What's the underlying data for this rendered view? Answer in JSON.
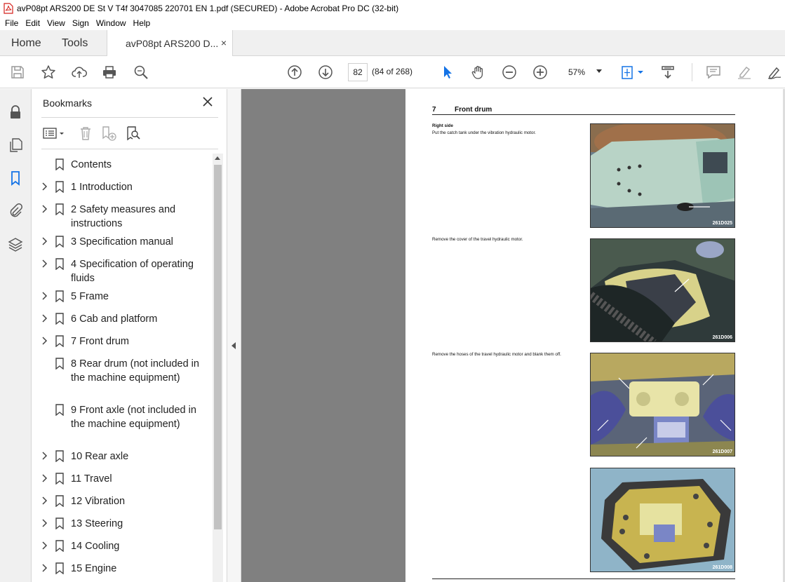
{
  "window": {
    "title": "avP08pt ARS200 DE St V T4f 3047085 220701 EN 1.pdf (SECURED) - Adobe Acrobat Pro DC (32-bit)"
  },
  "menu": [
    "File",
    "Edit",
    "View",
    "Sign",
    "Window",
    "Help"
  ],
  "tabs": {
    "home": "Home",
    "tools": "Tools",
    "document": "avP08pt ARS200 D...",
    "close_glyph": "×"
  },
  "toolbar": {
    "page_number": "82",
    "page_count": "(84 of 268)",
    "zoom": "57%"
  },
  "bookmarks": {
    "title": "Bookmarks",
    "items": [
      {
        "label": "Contents",
        "expandable": false
      },
      {
        "label": "1 Introduction",
        "expandable": true
      },
      {
        "label": "2 Safety measures and instructions",
        "expandable": true
      },
      {
        "label": "3 Specification manual",
        "expandable": true
      },
      {
        "label": "4 Specification of operating fluids",
        "expandable": true
      },
      {
        "label": "5 Frame",
        "expandable": true
      },
      {
        "label": "6 Cab and platform",
        "expandable": true
      },
      {
        "label": "7 Front drum",
        "expandable": true
      },
      {
        "label": "8 Rear drum (not included in the machine equipment)",
        "expandable": false
      },
      {
        "label": "9 Front axle (not included in the machine equipment)",
        "expandable": false
      },
      {
        "label": "10 Rear axle",
        "expandable": true
      },
      {
        "label": "11 Travel",
        "expandable": true
      },
      {
        "label": "12 Vibration",
        "expandable": true
      },
      {
        "label": "13 Steering",
        "expandable": true
      },
      {
        "label": "14 Cooling",
        "expandable": true
      },
      {
        "label": "15 Engine",
        "expandable": true
      }
    ]
  },
  "page": {
    "section_number": "7",
    "section_title": "Front drum",
    "subheading": "Right side",
    "step1": "Put the catch tank under the vibration hydraulic motor.",
    "step2": "Remove the cover of the travel hydraulic motor.",
    "step3": "Remove the hoses of the travel hydraulic motor and blank them off.",
    "photos": [
      "261D025",
      "261D006",
      "261D007",
      "261D008"
    ]
  },
  "colors": {
    "accent_blue": "#1473e6",
    "acrobat_red": "#d4211c",
    "icon_grey": "#555555",
    "viewer_bg": "#808080"
  }
}
